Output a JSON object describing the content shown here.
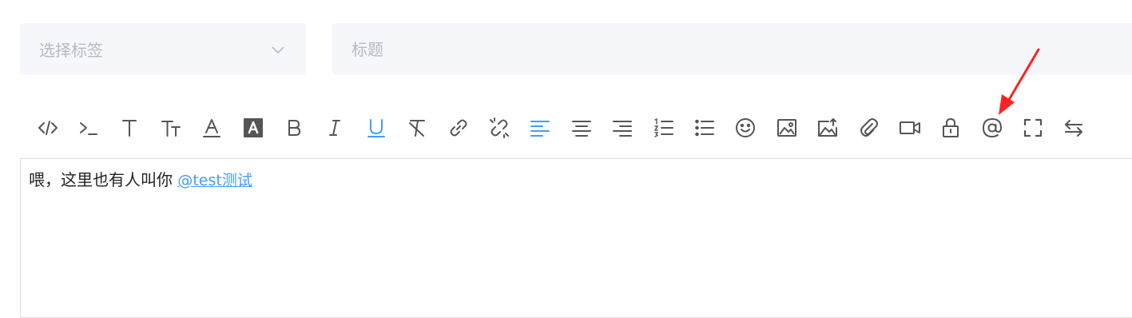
{
  "tag_select": {
    "placeholder": "选择标签",
    "icon": "chevron-down-icon"
  },
  "title_input": {
    "placeholder": "标题",
    "value": ""
  },
  "toolbar": {
    "active_color": "#409eff",
    "default_color": "#555555",
    "buttons": [
      {
        "icon": "code-icon"
      },
      {
        "icon": "terminal-icon"
      },
      {
        "icon": "heading-icon"
      },
      {
        "icon": "font-size-icon"
      },
      {
        "icon": "font-color-icon"
      },
      {
        "icon": "background-color-icon"
      },
      {
        "icon": "bold-icon"
      },
      {
        "icon": "italic-icon"
      },
      {
        "icon": "underline-icon",
        "active": true
      },
      {
        "icon": "clear-format-icon"
      },
      {
        "icon": "link-icon"
      },
      {
        "icon": "unlink-icon"
      },
      {
        "icon": "align-left-icon",
        "active": true
      },
      {
        "icon": "align-center-icon"
      },
      {
        "icon": "align-right-icon"
      },
      {
        "icon": "ordered-list-icon"
      },
      {
        "icon": "unordered-list-icon"
      },
      {
        "icon": "emoji-icon"
      },
      {
        "icon": "image-icon"
      },
      {
        "icon": "image-upload-icon"
      },
      {
        "icon": "attachment-icon"
      },
      {
        "icon": "video-icon"
      },
      {
        "icon": "lock-icon"
      },
      {
        "icon": "mention-icon"
      },
      {
        "icon": "fullscreen-icon"
      },
      {
        "icon": "switch-icon"
      }
    ]
  },
  "editor": {
    "text": "喂，这里也有人叫你",
    "mention": "@test测试"
  },
  "annotation": {
    "arrow_color": "#ff2222"
  }
}
